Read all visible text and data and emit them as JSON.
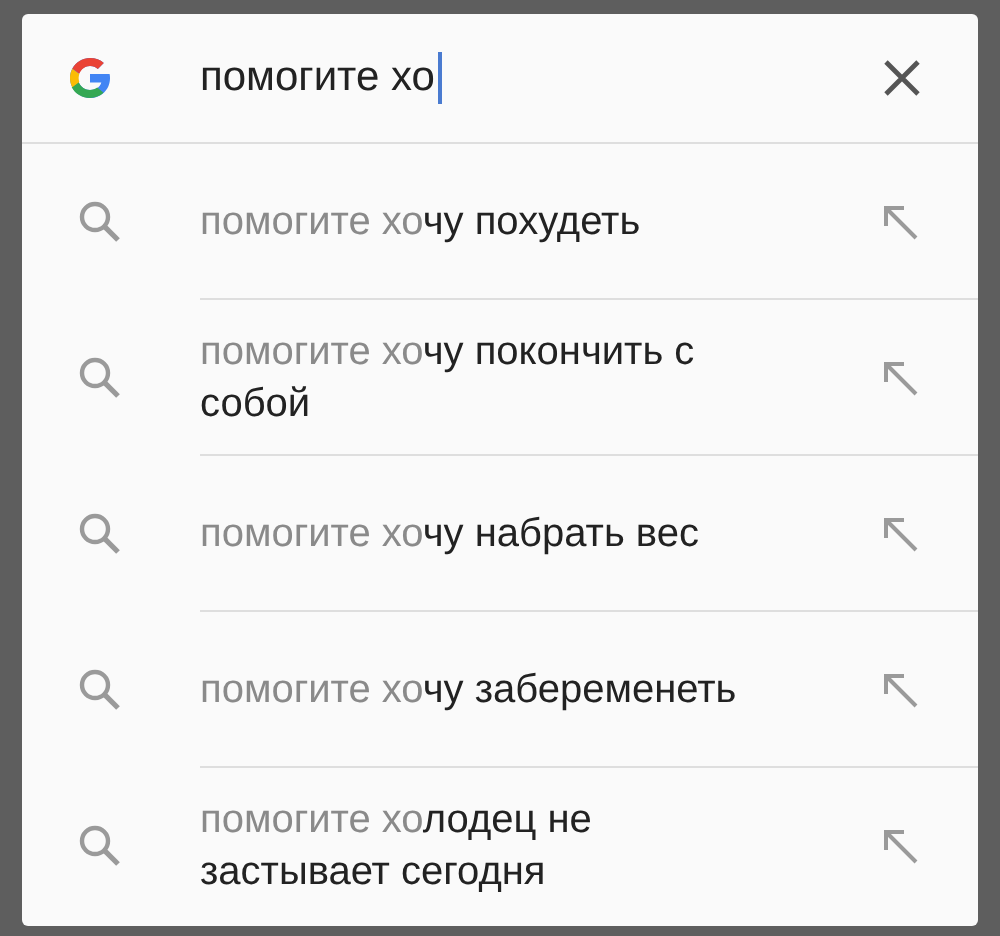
{
  "search": {
    "value": "помогите хо"
  },
  "suggestions": [
    {
      "typed": "помогите хо",
      "completion": "чу похудеть"
    },
    {
      "typed": "помогите хо",
      "completion": "чу покончить с собой"
    },
    {
      "typed": "помогите хо",
      "completion": "чу набрать вес"
    },
    {
      "typed": "помогите хо",
      "completion": "чу забеременеть"
    },
    {
      "typed": "помогите хо",
      "completion": "лодец не застывает сегодня"
    }
  ]
}
